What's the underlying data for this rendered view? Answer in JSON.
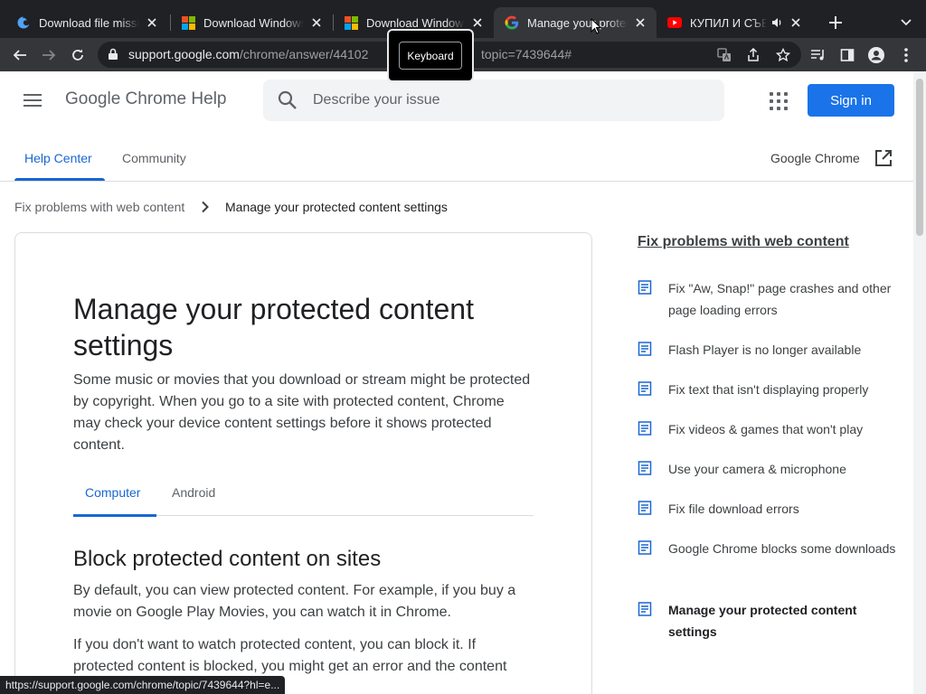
{
  "browser": {
    "tabs": [
      {
        "title": "Download file missing",
        "icon": "edge-swirl-icon"
      },
      {
        "title": "Download Windows",
        "icon": "microsoft-icon"
      },
      {
        "title": "Download Windows",
        "icon": "microsoft-icon"
      },
      {
        "title": "Manage your protected",
        "icon": "google-icon"
      },
      {
        "title": "КУПИЛ И СЪЕЛ",
        "icon": "youtube-icon"
      }
    ],
    "url_host": "support.google.com",
    "url_path": "/chrome/answer/44102",
    "url_tail": "topic=7439644#",
    "tooltip": "Keyboard"
  },
  "header": {
    "brand": "Google Chrome Help",
    "search_placeholder": "Describe your issue",
    "signin": "Sign in"
  },
  "nav": {
    "help_center": "Help Center",
    "community": "Community",
    "product": "Google Chrome"
  },
  "breadcrumb": {
    "parent": "Fix problems with web content",
    "current": "Manage your protected content settings"
  },
  "article": {
    "title": "Manage your protected content settings",
    "intro": "Some music or movies that you download or stream might be protected by copyright. When you go to a site with protected content, Chrome may check your device content settings before it shows protected content.",
    "tabs": [
      "Computer",
      "Android"
    ],
    "section_title": "Block protected content on sites",
    "para1": "By default, you can view protected content. For example, if you buy a movie on Google Play Movies, you can watch it in Chrome.",
    "para2": "If you don't want to watch protected content, you can block it. If protected content is blocked, you might get an error and the content"
  },
  "sidebar": {
    "title": "Fix problems with web content",
    "items": [
      "Fix \"Aw, Snap!\" page crashes and other page loading errors",
      "Flash Player is no longer available",
      "Fix text that isn't displaying properly",
      "Fix videos & games that won't play",
      "Use your camera & microphone",
      "Fix file download errors",
      "Google Chrome blocks some downloads",
      "Manage your protected content settings"
    ]
  },
  "status_url": "https://support.google.com/chrome/topic/7439644?hl=e...",
  "colors": {
    "accent": "#1a73e8",
    "link": "#1967d2",
    "tabstrip": "#202124",
    "toolbar": "#35363a"
  }
}
